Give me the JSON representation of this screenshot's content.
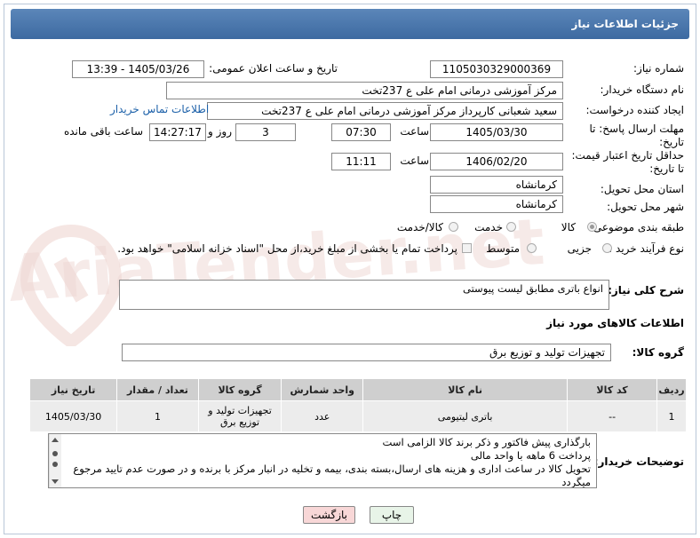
{
  "header": {
    "title": "جزئیات اطلاعات نیاز"
  },
  "watermark": {
    "text": "AriaTender.net"
  },
  "fields": {
    "need_number_label": "شماره نیاز:",
    "need_number": "1105030329000369",
    "announce_label": "تاریخ و ساعت اعلان عمومی:",
    "announce_value": "1405/03/26 - 13:39",
    "buyer_org_label": "نام دستگاه خریدار:",
    "buyer_org": "مرکز آموزشی درمانی امام علی ع 237تخت",
    "requester_label": "ایجاد کننده درخواست:",
    "requester": "سعید شعبانی کارپرداز  مرکز آموزشی درمانی امام علی ع 237تخت",
    "contact_link": "اطلاعات تماس خریدار",
    "reply_deadline_label_1": "مهلت ارسال پاسخ: تا",
    "reply_deadline_label_2": "تاریخ:",
    "reply_date": "1405/03/30",
    "time_label": "ساعت",
    "reply_time": "07:30",
    "days_value": "3",
    "days_label": "روز و",
    "remaining_value": "14:27:17",
    "remaining_label": "ساعت باقی مانده",
    "min_validity_label_1": "حداقل تاریخ اعتبار قیمت:",
    "min_validity_label_2": "تا تاریخ:",
    "validity_date": "1406/02/20",
    "validity_time": "11:11",
    "province_label": "استان محل تحویل:",
    "province": "کرمانشاه",
    "city_label": "شهر محل تحویل:",
    "city": "کرمانشاه",
    "category_label": "طبقه بندی موضوعی:",
    "category_options": [
      "کالا",
      "خدمت",
      "کالا/خدمت"
    ],
    "category_selected": "کالا",
    "process_label": "نوع فرآیند خرید :",
    "process_options": [
      "جزیی",
      "متوسط"
    ],
    "process_note": "پرداخت تمام یا بخشی از مبلغ خرید،از محل \"اسناد خزانه اسلامی\" خواهد بود."
  },
  "description": {
    "label": "شرح کلی نیاز:",
    "value": "انواع باتری مطابق لیست پیوستی"
  },
  "goods_info": {
    "title": "اطلاعات کالاهای مورد نیاز"
  },
  "goods_group": {
    "label": "گروه کالا:",
    "value": "تجهیزات تولید و توزیع برق"
  },
  "table": {
    "headers": [
      "ردیف",
      "کد کالا",
      "نام کالا",
      "واحد شمارش",
      "گروه کالا",
      "تعداد / مقدار",
      "تاریخ نیاز"
    ],
    "rows": [
      {
        "row": "1",
        "code": "--",
        "name": "باتری لیتیومی",
        "unit": "عدد",
        "group": "تجهیزات تولید و توزیع برق",
        "qty": "1",
        "date": "1405/03/30"
      }
    ]
  },
  "buyer_notes": {
    "label": "توضیحات خریدار:",
    "lines": [
      "بارگذاری پیش فاکتور و ذکر برند کالا الزامی است",
      "پرداخت 6 ماهه با واحد مالی",
      "تحویل کالا در ساعت اداری و هزینه های ارسال،بسته بندی، بیمه و تخلیه در انبار مرکز با برنده و در صورت عدم تایید مرجوع",
      "میگردد"
    ]
  },
  "buttons": {
    "print": "چاپ",
    "back": "بازگشت"
  },
  "colors": {
    "header": "#4a76ab",
    "link": "#1a5fa8",
    "back_button": "#f8d7d7",
    "print_button": "#e3f2e3"
  }
}
